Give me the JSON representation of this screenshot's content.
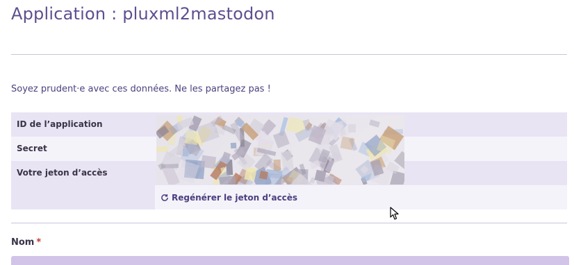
{
  "header": {
    "title": "Application : pluxml2mastodon"
  },
  "warning_text": "Soyez prudent·e avec ces données. Ne les partagez pas !",
  "credentials": {
    "rows": [
      {
        "label": "ID de l’application"
      },
      {
        "label": "Secret"
      },
      {
        "label": "Votre jeton d’accès"
      }
    ],
    "regenerate_label": "Regénérer le jeton d’accès"
  },
  "form": {
    "name_label": "Nom",
    "required_marker": "*",
    "name_value": ""
  },
  "colors": {
    "title": "#5e4f8f",
    "row_dark": "#e9e4f4",
    "row_light": "#f5f3fa",
    "field_bg": "#d1c4e8",
    "required": "#c0392b"
  }
}
